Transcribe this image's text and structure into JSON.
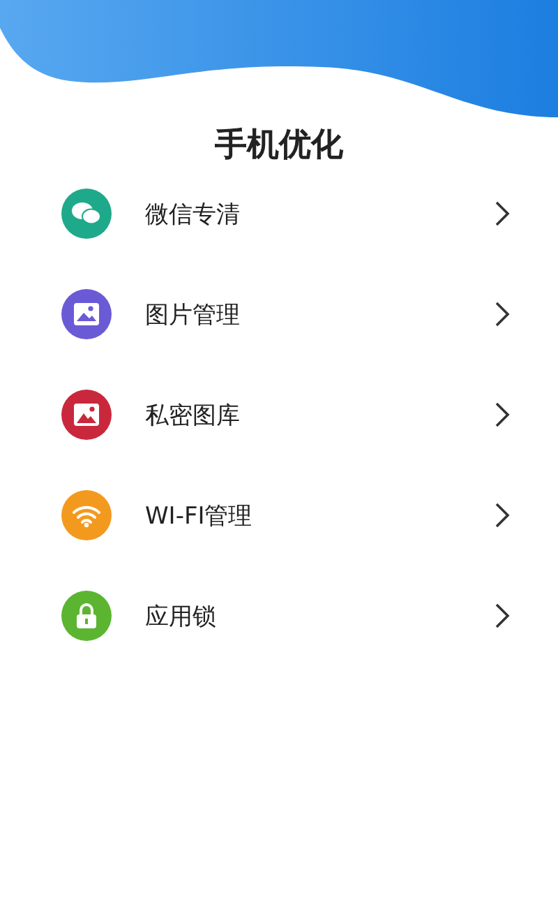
{
  "title": "手机优化",
  "items": [
    {
      "label": "微信专清",
      "kind": "chat",
      "color": "#1fa98b"
    },
    {
      "label": "图片管理",
      "kind": "image",
      "color": "#6b5ad6"
    },
    {
      "label": "私密图库",
      "kind": "gallery",
      "color": "#c9283c"
    },
    {
      "label": "WI-FI管理",
      "kind": "wifi",
      "color": "#f39a1e"
    },
    {
      "label": "应用锁",
      "kind": "lock",
      "color": "#5cb531"
    }
  ]
}
